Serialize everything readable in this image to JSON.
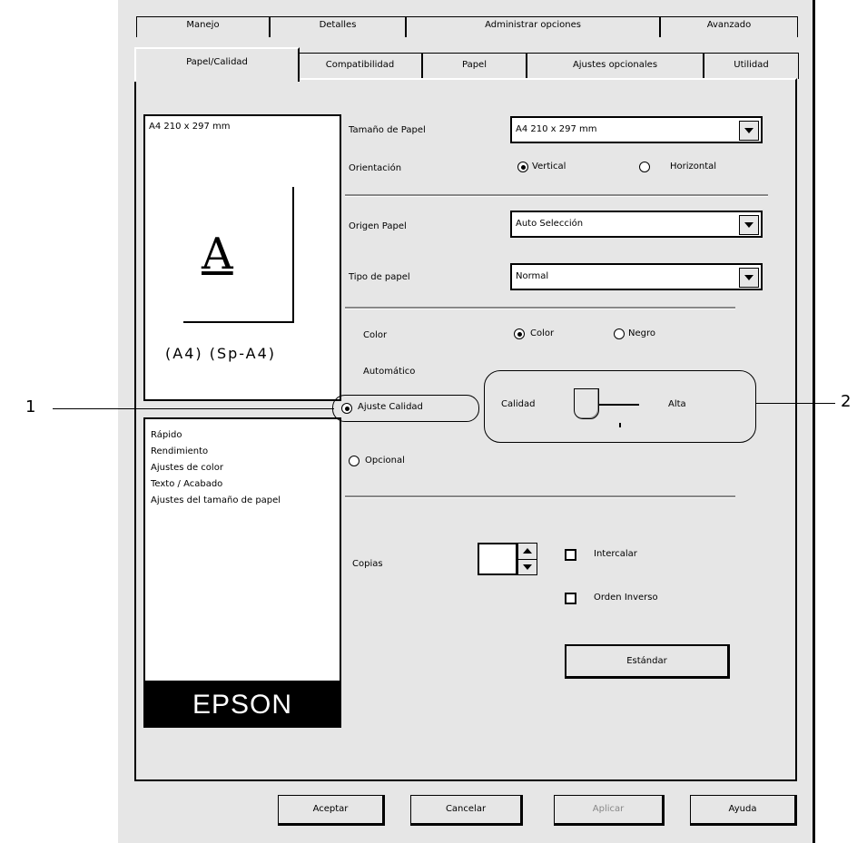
{
  "tabs_row1": [
    {
      "label": "Manejo"
    },
    {
      "label": "Detalles"
    },
    {
      "label": "Administrar opciones"
    },
    {
      "label": "Avanzado"
    }
  ],
  "tabs_row2": [
    {
      "label": "Papel/Calidad"
    },
    {
      "label": "Compatibilidad"
    },
    {
      "label": "Papel"
    },
    {
      "label": "Ajustes opcionales"
    },
    {
      "label": "Utilidad"
    }
  ],
  "preview": {
    "paper_title": "A4 210 x 297 mm",
    "glyph": "A",
    "caption": "(A4) (Sp-A4)"
  },
  "list": {
    "items": [
      "Rápido",
      "Rendimiento",
      "Ajustes de color",
      "Texto / Acabado",
      "Ajustes del tamaño de papel"
    ]
  },
  "logo": "EPSON",
  "form": {
    "paper_size_label": "Tamaño de Papel",
    "paper_size_value": "A4 210 x 297 mm",
    "orientation_label": "Orientación",
    "orientation_vertical": "Vertical",
    "orientation_horizontal": "Horizontal",
    "paper_source_label": "Origen Papel",
    "paper_source_value": "Auto Selección",
    "paper_type_label": "Tipo de papel",
    "paper_type_value": "Normal",
    "color_label": "Color",
    "color_option": "Color",
    "black_option": "Negro",
    "auto_label": "Automático",
    "auto_option": "Ajuste Calidad",
    "quality_label": "Calidad",
    "slider_right": "Alta",
    "custom_option": "Opcional",
    "copies_label": "Copias",
    "copies_value": "",
    "collate_label": "Intercalar",
    "reverse_label": "Orden Inverso",
    "restore_button": "Estándar"
  },
  "footer": {
    "ok": "Aceptar",
    "cancel": "Cancelar",
    "apply": "Aplicar",
    "help": "Ayuda"
  },
  "callouts": {
    "one": "1",
    "two": "2"
  }
}
